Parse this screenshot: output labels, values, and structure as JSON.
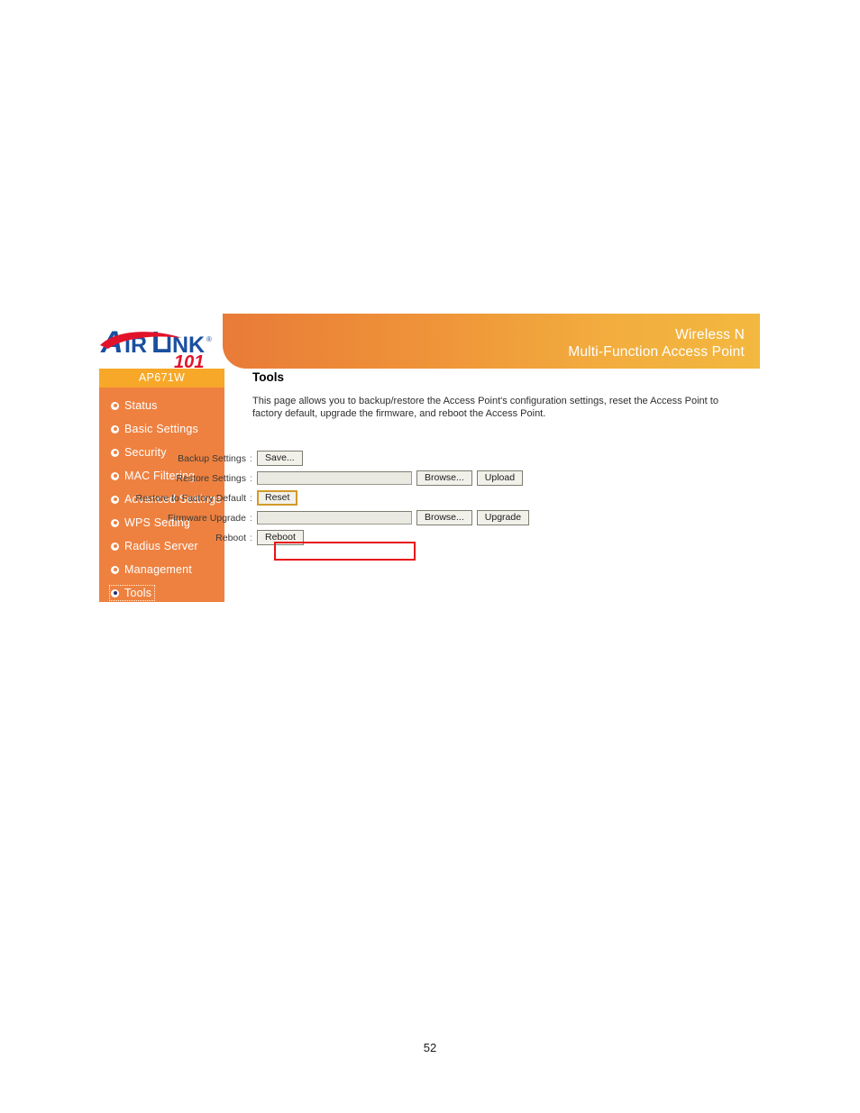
{
  "document": {
    "page_number": "52"
  },
  "banner": {
    "line1": "Wireless N",
    "line2": "Multi-Function Access Point",
    "gradient_start": "#e87b38",
    "gradient_end": "#f3b83f"
  },
  "logo": {
    "brand": "AIRLINK",
    "brand_part1": "A",
    "brand_part2": "IR",
    "brand_part3": "L",
    "brand_part4": "INK",
    "suffix": "101",
    "registered": "®",
    "blue": "#1a4fa0",
    "red": "#e3122b"
  },
  "sidebar": {
    "title": "AP671W",
    "background": "#ee8140",
    "title_background": "#f7a828",
    "items": [
      {
        "label": "Status",
        "selected": false
      },
      {
        "label": "Basic Settings",
        "selected": false
      },
      {
        "label": "Security",
        "selected": false
      },
      {
        "label": "MAC Filtering",
        "selected": false
      },
      {
        "label": "Advanced Settings",
        "selected": false
      },
      {
        "label": "WPS Setting",
        "selected": false
      },
      {
        "label": "Radius Server",
        "selected": false
      },
      {
        "label": "Management",
        "selected": false
      },
      {
        "label": "Tools",
        "selected": true
      }
    ]
  },
  "content": {
    "title": "Tools",
    "description": "This page allows you to backup/restore the Access Point's configuration settings, reset the Access Point to factory default, upgrade the firmware, and reboot the Access Point."
  },
  "form": {
    "colon": ":",
    "rows": [
      {
        "label": "Backup Settings",
        "type": "button",
        "button": "Save...",
        "input_value": "",
        "input_placeholder": ""
      },
      {
        "label": "Restore Settings",
        "type": "file",
        "input_value": "",
        "input_placeholder": "",
        "browse": "Browse...",
        "action": "Upload"
      },
      {
        "label": "Restore to Factory Default",
        "type": "button",
        "button": "Reset",
        "focused": true,
        "focus_color": "#d39a2b"
      },
      {
        "label": "Firmware Upgrade",
        "type": "file",
        "input_value": "",
        "input_placeholder": "",
        "browse": "Browse...",
        "action": "Upgrade"
      },
      {
        "label": "Reboot",
        "type": "button",
        "button": "Reboot",
        "annotated": true
      }
    ]
  },
  "annotation": {
    "color": "#e8111a",
    "target": "Reboot"
  }
}
